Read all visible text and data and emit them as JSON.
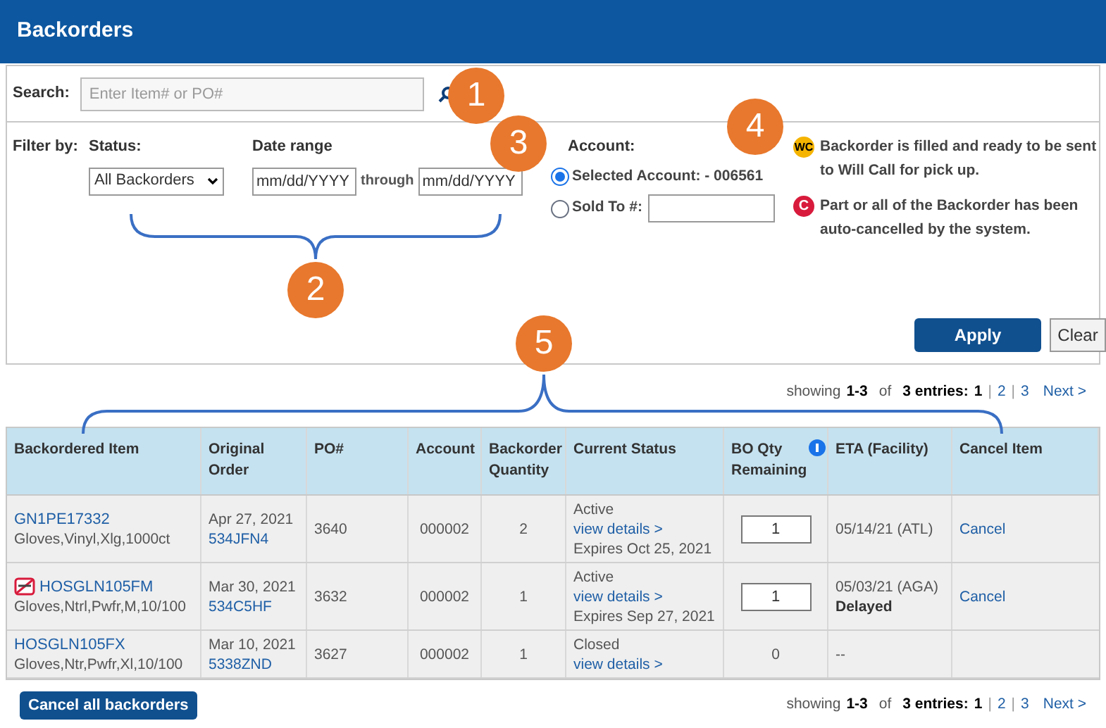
{
  "header": {
    "title": "Backorders"
  },
  "search": {
    "label": "Search:",
    "placeholder": "Enter Item# or PO#"
  },
  "filter": {
    "label": "Filter by:",
    "status_label": "Status:",
    "status_value": "All Backorders",
    "date_label": "Date range",
    "date_from": "mm/dd/YYYY",
    "through": "through",
    "date_to": "mm/dd/YYYY",
    "account_label": "Account:",
    "account_options": [
      {
        "label": "Selected Account: - 006561",
        "selected": true,
        "kind": "plain"
      },
      {
        "label": "Sold To #:",
        "selected": false,
        "kind": "field"
      }
    ]
  },
  "legend": [
    {
      "kind": "will-call",
      "badge": "WC",
      "text": "Backorder is filled and ready to be sent to Will Call for pick up."
    },
    {
      "kind": "cancelled",
      "badge": "C",
      "text": "Part or all of the Backorder has been auto-cancelled by the system."
    }
  ],
  "buttons": {
    "apply": "Apply",
    "clear": "Clear",
    "cancel_all": "Cancel all backorders"
  },
  "pagination_top": {
    "showing": "showing",
    "range": "1-3",
    "of": "of",
    "entries": "3 entries:",
    "pages": [
      {
        "label": "1",
        "selected": true
      },
      {
        "label": "2",
        "selected": false
      },
      {
        "label": "3",
        "selected": false
      }
    ],
    "separators": [
      "|",
      "|"
    ],
    "next": "Next >"
  },
  "pagination_bottom": {
    "showing": "showing",
    "range": "1-3",
    "of": "of",
    "entries": "3 entries:",
    "pages": [
      {
        "label": "1",
        "selected": true
      },
      {
        "label": "2",
        "selected": false
      },
      {
        "label": "3",
        "selected": false
      }
    ],
    "separators": [
      "|",
      "|"
    ],
    "next": "Next >"
  },
  "table": {
    "columns": [
      "Backordered Item",
      "Original Order",
      "PO#",
      "Account",
      "Backorder Quantity",
      "Current Status",
      "BO Qty Remaining",
      "ETA (Facility)",
      "Cancel Item"
    ],
    "rows": [
      {
        "item": "GN1PE17332",
        "description": "Gloves,Vinyl,Xlg,1000ct",
        "restricted": false,
        "date": "Apr 27, 2021",
        "order": "534JFN4",
        "po": "3640",
        "account": "000002",
        "quantity": "2",
        "status": "Active",
        "details": "view details >",
        "expires": "Expires Oct 25, 2021",
        "remaining": "1",
        "editable": true,
        "eta": "05/14/21 (ATL)",
        "cancel": "Cancel"
      },
      {
        "item": "HOSGLN105FM",
        "description": "Gloves,Ntrl,Pwfr,M,10/100",
        "restricted": true,
        "date": "Mar 30, 2021",
        "order": "534C5HF",
        "po": "3632",
        "account": "000002",
        "quantity": "1",
        "status": "Active",
        "details": "view details >",
        "expires": "Expires Sep 27, 2021",
        "remaining": "1",
        "editable": true,
        "eta": "05/03/21 (AGA)",
        "eta_note": "Delayed",
        "cancel": "Cancel"
      },
      {
        "item": "HOSGLN105FX",
        "description": "Gloves,Ntr,Pwfr,Xl,10/100",
        "restricted": false,
        "date": "Mar 10, 2021",
        "order": "5338ZND",
        "po": "3627",
        "account": "000002",
        "quantity": "1",
        "status": "Closed",
        "details": "view details >",
        "remaining": "0",
        "editable": false,
        "eta": "--"
      }
    ]
  },
  "callouts": [
    "1",
    "2",
    "3",
    "4",
    "5"
  ]
}
